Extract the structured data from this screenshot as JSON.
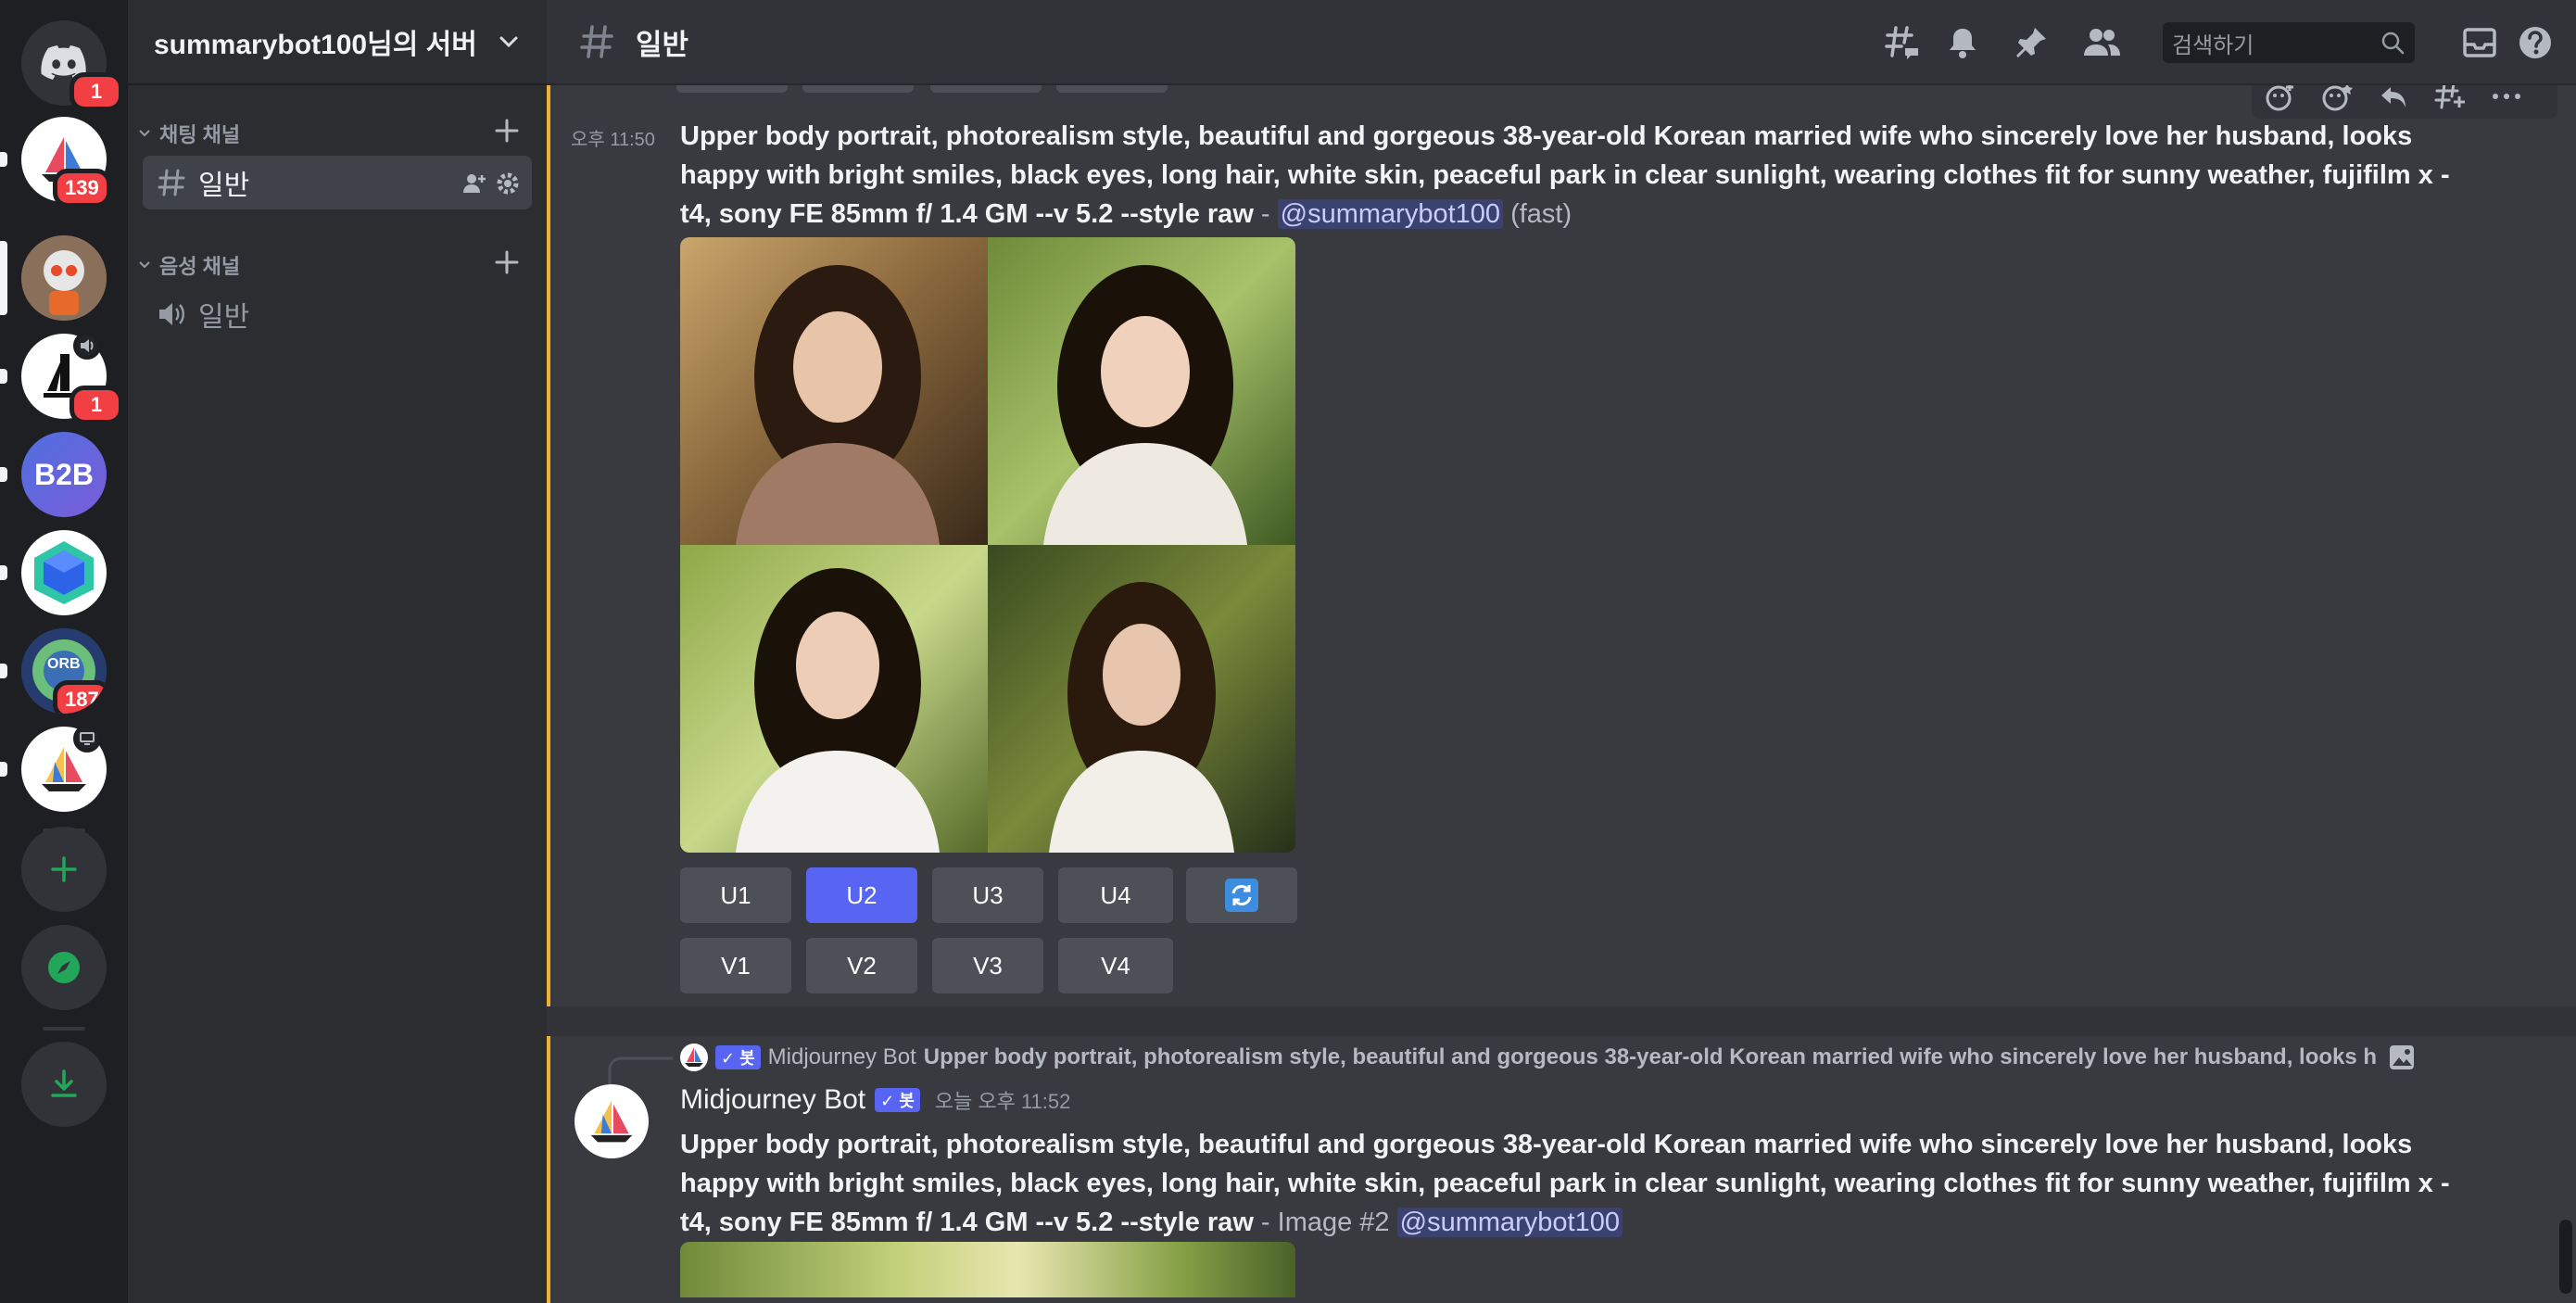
{
  "rail": {
    "home_badge": "1",
    "servers": [
      {
        "name": "sailboat-server",
        "badge": "139"
      },
      {
        "name": "robot-server",
        "badge": ""
      },
      {
        "name": "ai-art-server",
        "badge": "1"
      },
      {
        "name": "b2b-server",
        "label": "B2B",
        "badge": ""
      },
      {
        "name": "cube-server",
        "badge": ""
      },
      {
        "name": "orb-server",
        "label": "ORB",
        "badge": "187"
      },
      {
        "name": "midjourney-server",
        "badge": ""
      }
    ]
  },
  "sidebar": {
    "guild_name": "summarybot100님의 서버",
    "text_category": "채팅 채널",
    "voice_category": "음성 채널",
    "text_channel": "일반",
    "voice_channel": "일반"
  },
  "topbar": {
    "channel_name": "일반",
    "search_placeholder": "검색하기"
  },
  "message1": {
    "timestamp": "오후 11:50",
    "prompt": "Upper body portrait, photorealism style, beautiful and gorgeous 38-year-old Korean married wife who sincerely love her husband, looks happy with bright smiles, black eyes, long hair, white skin, peaceful park in clear sunlight, wearing clothes fit for sunny weather, fujifilm x - t4, sony FE 85mm f/ 1.4 GM --v 5.2 --style raw",
    "separator": " - ",
    "mention": "@summarybot100",
    "speed": "(fast)",
    "buttons_u": [
      "U1",
      "U2",
      "U3",
      "U4"
    ],
    "buttons_v": [
      "V1",
      "V2",
      "V3",
      "V4"
    ]
  },
  "message2": {
    "reply_author": "Midjourney Bot",
    "reply_bot_tag": "✓ 봇",
    "reply_text": "Upper body portrait, photorealism style, beautiful and gorgeous 38-year-old Korean married wife who sincerely love her husband, looks h",
    "author": "Midjourney Bot",
    "bot_tag": "✓ 봇",
    "timestamp": "오늘 오후 11:52",
    "prompt": "Upper body portrait, photorealism style, beautiful and gorgeous 38-year-old Korean married wife who sincerely love her husband, looks happy with bright smiles, black eyes, long hair, white skin, peaceful park in clear sunlight, wearing clothes fit for sunny weather, fujifilm x - t4, sony FE 85mm f/ 1.4 GM --v 5.2 --style raw",
    "suffix": " - Image #2 ",
    "mention": "@summarybot100"
  },
  "colors": {
    "accent": "#5865f2",
    "highlight_border": "#f0b132",
    "badge": "#f23f43"
  }
}
